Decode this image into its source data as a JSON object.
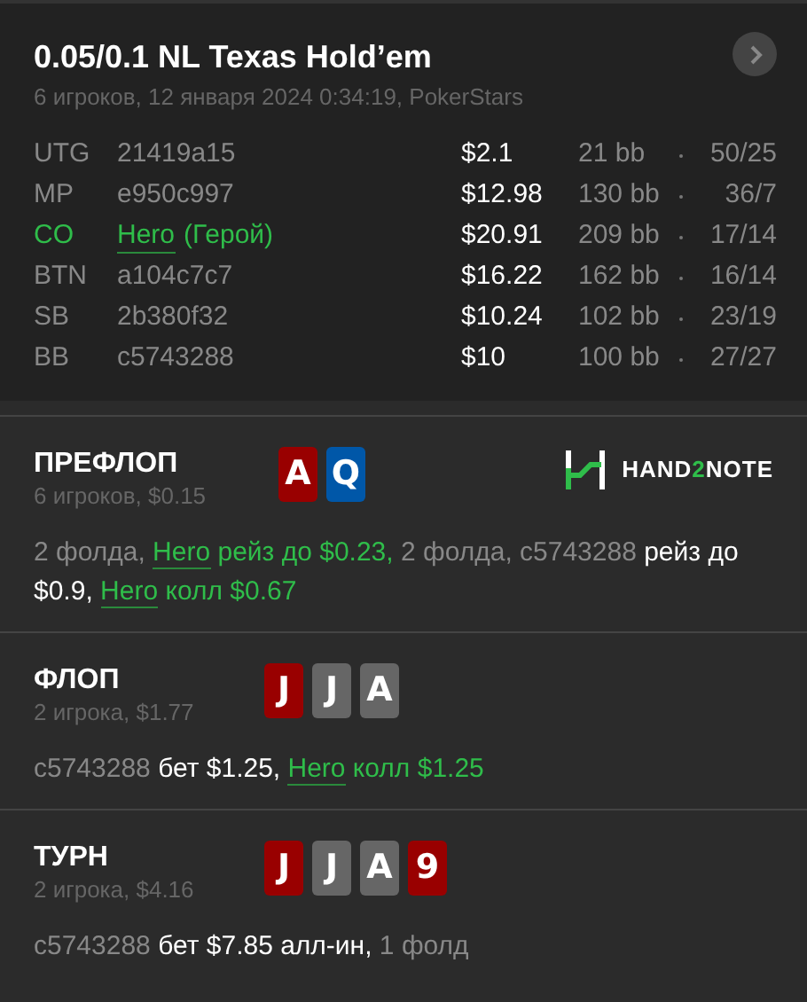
{
  "header": {
    "title": "0.05/0.1 NL Texas Hold’em",
    "subtitle": "6 игроков, 12 января 2024 0:34:19, PokerStars"
  },
  "players": [
    {
      "position": "UTG",
      "name": "21419a15",
      "hero": false,
      "stack": "$2.1",
      "bb": "21 bb",
      "stats": "50/25"
    },
    {
      "position": "MP",
      "name": "e950c997",
      "hero": false,
      "stack": "$12.98",
      "bb": "130 bb",
      "stats": "36/7"
    },
    {
      "position": "CO",
      "name": "Hero",
      "suffix": "(Герой)",
      "hero": true,
      "stack": "$20.91",
      "bb": "209 bb",
      "stats": "17/14"
    },
    {
      "position": "BTN",
      "name": "a104c7c7",
      "hero": false,
      "stack": "$16.22",
      "bb": "162 bb",
      "stats": "16/14"
    },
    {
      "position": "SB",
      "name": "2b380f32",
      "hero": false,
      "stack": "$10.24",
      "bb": "102 bb",
      "stats": "23/19"
    },
    {
      "position": "BB",
      "name": "c5743288",
      "hero": false,
      "stack": "$10",
      "bb": "100 bb",
      "stats": "27/27"
    }
  ],
  "logo": [
    "HAND",
    "2",
    "NOTE"
  ],
  "streets": [
    {
      "title": "ПРЕФЛОП",
      "subtitle": "6 игроков, $0.15",
      "cards": [
        {
          "rank": "A",
          "color": "#990000"
        },
        {
          "rank": "Q",
          "color": "#0057a8"
        }
      ],
      "actions": [
        {
          "text": "2 фолда, ",
          "kind": "muted"
        },
        {
          "text": "Hero",
          "kind": "link"
        },
        {
          "text": " рейз до $0.23,",
          "kind": "hero"
        },
        {
          "text": " 2 фолда, c5743288",
          "kind": "muted"
        },
        {
          "text": " рейз до $0.9, ",
          "kind": "plain"
        },
        {
          "text": "Hero",
          "kind": "link"
        },
        {
          "text": " колл $0.67",
          "kind": "hero"
        }
      ]
    },
    {
      "title": "ФЛОП",
      "subtitle": "2 игрока, $1.77",
      "cards": [
        {
          "rank": "J",
          "color": "#990000"
        },
        {
          "rank": "J",
          "color": "#666666"
        },
        {
          "rank": "A",
          "color": "#666666"
        }
      ],
      "actions": [
        {
          "text": "c5743288",
          "kind": "muted"
        },
        {
          "text": " бет $1.25, ",
          "kind": "plain"
        },
        {
          "text": "Hero",
          "kind": "link"
        },
        {
          "text": " колл $1.25",
          "kind": "hero"
        }
      ]
    },
    {
      "title": "ТУРН",
      "subtitle": "2 игрока, $4.16",
      "cards": [
        {
          "rank": "J",
          "color": "#990000"
        },
        {
          "rank": "J",
          "color": "#666666"
        },
        {
          "rank": "A",
          "color": "#666666"
        },
        {
          "rank": "9",
          "color": "#990000"
        }
      ],
      "actions": [
        {
          "text": "c5743288",
          "kind": "muted"
        },
        {
          "text": " бет $7.85 алл-ин,",
          "kind": "plain"
        },
        {
          "text": " 1 фолд",
          "kind": "muted"
        }
      ]
    }
  ]
}
